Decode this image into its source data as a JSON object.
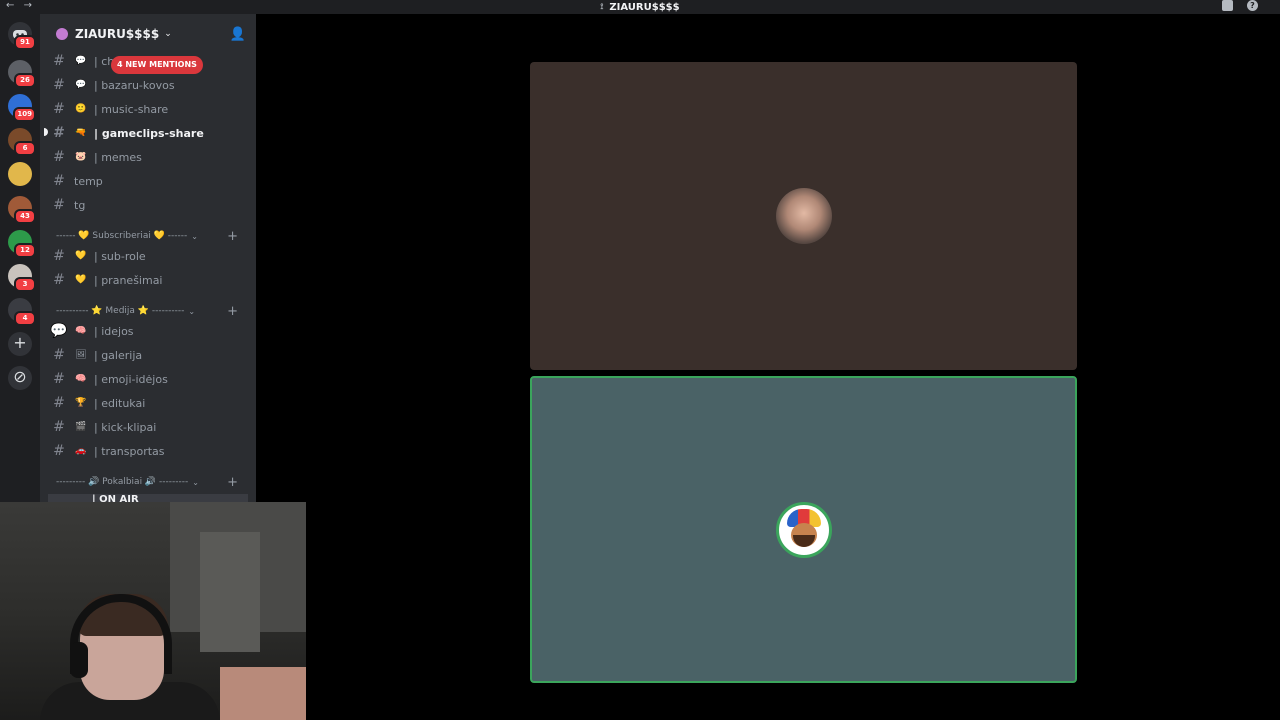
{
  "titlebar": {
    "back": "←",
    "forward": "→",
    "server_title": "ZIAURU$$$$"
  },
  "rail": {
    "badges": [
      "91",
      "26",
      "109",
      "6",
      "43",
      "12",
      "3",
      "4"
    ],
    "add_icon": "+",
    "explore_icon": "⊘"
  },
  "server": {
    "name": "ZIAURU$$$$",
    "chevron": "⌄"
  },
  "mentions_pill": "4 NEW MENTIONS",
  "channels_top": [
    {
      "emoji": "💬",
      "label": "| ch"
    },
    {
      "emoji": "💬",
      "label": "| bazaru-kovos"
    },
    {
      "emoji": "🙂",
      "label": "| music-share"
    },
    {
      "emoji": "🔫",
      "label": "| gameclips-share"
    },
    {
      "emoji": "🐷",
      "label": "| memes"
    },
    {
      "emoji": "",
      "label": "temp"
    },
    {
      "emoji": "",
      "label": "tg"
    }
  ],
  "category_sub": "------ 💛 Subscriberiai 💛 ------",
  "channels_sub": [
    {
      "emoji": "💛",
      "label": "| sub-role"
    },
    {
      "emoji": "💛",
      "label": "| pranešimai"
    }
  ],
  "category_media": "---------- ⭐ Medija ⭐ ----------",
  "channels_media": [
    {
      "emoji": "🧠",
      "label": "| idejos"
    },
    {
      "emoji": "🖼",
      "label": "| galerija"
    },
    {
      "emoji": "🧠",
      "label": "| emoji-idėjos"
    },
    {
      "emoji": "🏆",
      "label": "| editukai"
    },
    {
      "emoji": "🎬",
      "label": "| kick-klipai"
    },
    {
      "emoji": "🚗",
      "label": "| transportas"
    }
  ],
  "category_voice": "--------- 🔊 Pokalbiai 🔊 ---------",
  "voice_channel": "| ON AIR",
  "colors": {
    "speaking": "#3ba55c",
    "mention": "#da373c"
  }
}
